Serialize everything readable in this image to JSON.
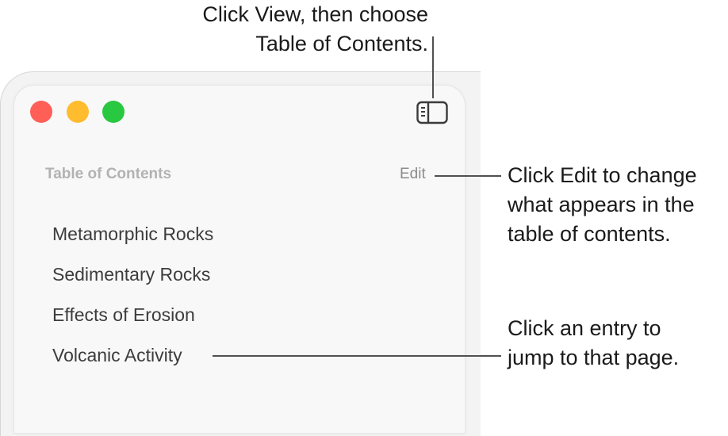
{
  "window": {
    "sidebar_toggle_icon": "sidebar-toggle-icon",
    "toc": {
      "header": "Table of Contents",
      "edit_label": "Edit",
      "entries": [
        {
          "label": "Metamorphic Rocks"
        },
        {
          "label": "Sedimentary Rocks"
        },
        {
          "label": "Effects of Erosion"
        },
        {
          "label": "Volcanic Activity"
        }
      ]
    }
  },
  "callouts": {
    "view": {
      "line1": "Click View, then choose",
      "line2": "Table of Contents."
    },
    "edit": {
      "line1": "Click Edit to change",
      "line2": "what appears in the",
      "line3": "table of contents."
    },
    "entry": {
      "line1": "Click an entry to",
      "line2": "jump to that page."
    }
  },
  "colors": {
    "close": "#ff5f57",
    "minimize": "#febc2e",
    "zoom": "#28c840",
    "leader_line": "#505050"
  }
}
